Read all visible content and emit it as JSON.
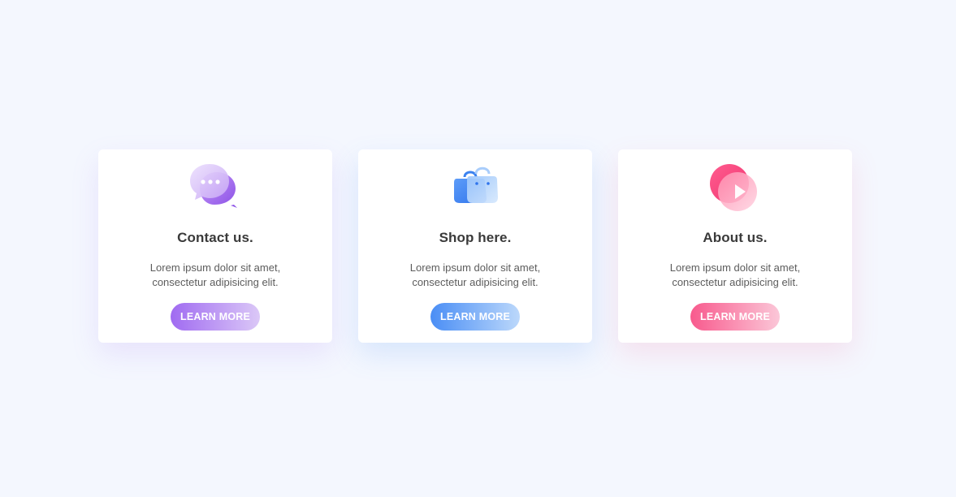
{
  "cards": [
    {
      "icon": "chat-bubbles-icon",
      "title": "Contact us.",
      "description_line1": "Lorem ipsum dolor sit amet,",
      "description_line2": "consectetur adipisicing elit.",
      "button_label": "LEARN MORE",
      "accent": "#a06bf1"
    },
    {
      "icon": "shopping-bags-icon",
      "title": "Shop here.",
      "description_line1": "Lorem ipsum dolor sit amet,",
      "description_line2": "consectetur adipisicing elit.",
      "button_label": "LEARN MORE",
      "accent": "#4a8ef5"
    },
    {
      "icon": "play-video-icon",
      "title": "About us.",
      "description_line1": "Lorem ipsum dolor sit amet,",
      "description_line2": "consectetur adipisicing elit.",
      "button_label": "LEARN MORE",
      "accent": "#f85a8d"
    }
  ]
}
